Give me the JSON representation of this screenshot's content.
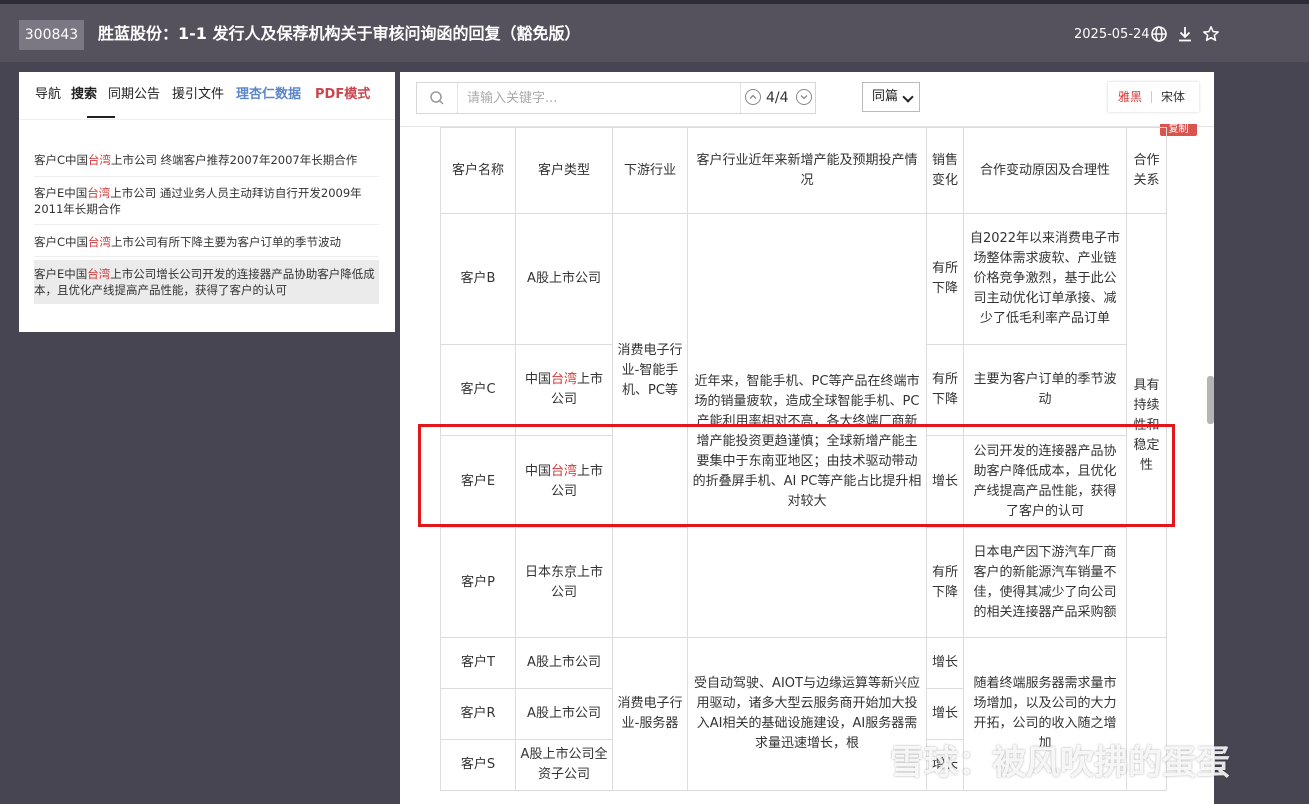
{
  "header": {
    "stock_code": "300843",
    "title": "胜蓝股份：1-1 发行人及保荐机构关于审核问询函的回复（豁免版）",
    "date": "2025-05-24"
  },
  "left_panel": {
    "tabs": [
      "导航",
      "搜索",
      "同期公告",
      "援引文件",
      "理杏仁数据",
      "PDF模式"
    ],
    "active_tab": "搜索",
    "results": [
      {
        "pre": "客户C中国",
        "hl": "台湾",
        "post": "上市公司 终端客户推荐2007年2007年长期合作"
      },
      {
        "pre": "客户E中国",
        "hl": "台湾",
        "post": "上市公司 通过业务人员主动拜访自行开发2009年2011年长期合作"
      },
      {
        "pre": "客户C中国",
        "hl": "台湾",
        "post": "上市公司有所下降主要为客户订单的季节波动"
      },
      {
        "pre": "客户E中国",
        "hl": "台湾",
        "post": "上市公司增长公司开发的连接器产品协助客户降低成本，且优化产线提高产品性能，获得了客户的认可"
      }
    ]
  },
  "toolbar": {
    "search_placeholder": "请输入关键字...",
    "match_count": "4/4",
    "scope": "同篇",
    "font_options": [
      "雅黑",
      "宋体"
    ],
    "copy_label": "复制"
  },
  "table": {
    "headers": {
      "name": "客户名称",
      "type": "客户类型",
      "industry": "下游行业",
      "capacity": "客户行业近年来新增产能及预期投产情况",
      "sales": "销售变化",
      "reason": "合作变动原因及合理性",
      "relation": "合作关系"
    },
    "rows": [
      {
        "name": "客户B",
        "type_pre": "A股上市公司",
        "type_hl": "",
        "type_post": "",
        "sales": "有所下降",
        "reason": "自2022年以来消费电子市场整体需求疲软、产业链价格竞争激烈，基于此公司主动优化订单承接、减少了低毛利率产品订单"
      },
      {
        "name": "客户C",
        "type_pre": "中国",
        "type_hl": "台湾",
        "type_post": "上市公司",
        "sales": "有所下降",
        "reason": "主要为客户订单的季节波动"
      },
      {
        "name": "客户E",
        "type_pre": "中国",
        "type_hl": "台湾",
        "type_post": "上市公司",
        "sales": "增长",
        "reason": "公司开发的连接器产品协助客户降低成本，且优化产线提高产品性能，获得了客户的认可"
      },
      {
        "name": "客户P",
        "type_pre": "日本东京上市公司",
        "type_hl": "",
        "type_post": "",
        "sales": "有所下降",
        "reason": "日本电产因下游汽车厂商客户的新能源汽车销量不佳，使得其减少了向公司的相关连接器产品采购额"
      },
      {
        "name": "客户T",
        "type_pre": "A股上市公司",
        "type_hl": "",
        "type_post": "",
        "sales": "增长",
        "reason": "随着终端服务器需求量市场增加，以及公司的大力开拓，公司的收入随之增加"
      },
      {
        "name": "客户R",
        "type_pre": "A股上市公司",
        "type_hl": "",
        "type_post": "",
        "sales": "增长",
        "reason": ""
      },
      {
        "name": "客户S",
        "type_pre": "A股上市公司全资子公司",
        "type_hl": "",
        "type_post": "",
        "sales": "增长",
        "reason": ""
      }
    ],
    "industry_consumer": "消费电子行业-智能手机、PC等",
    "industry_server": "消费电子行业-服务器",
    "capacity_consumer": "近年来，智能手机、PC等产品在终端市场的销量疲软，造成全球智能手机、PC产能利用率相对不高，各大终端厂商新增产能投资更趋谨慎；全球新增产能主要集中于东南亚地区；由技术驱动带动的折叠屏手机、AI PC等产能占比提升相对较大",
    "capacity_server": "受自动驾驶、AIOT与边缘运算等新兴应用驱动，诸多大型云服务商开始加大投入AI相关的基础设施建设，AI服务器需求量迅速增长，根",
    "relation": "具有持续性和稳定性"
  },
  "watermark": "雪球：被风吹拂的蛋蛋"
}
